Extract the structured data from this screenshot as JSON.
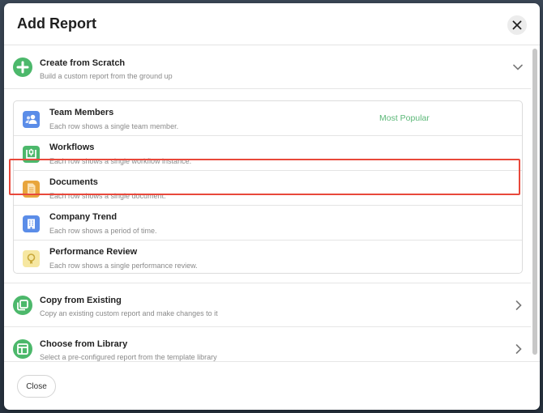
{
  "dialog": {
    "title": "Add Report",
    "close_icon": "close-icon"
  },
  "sections": {
    "create": {
      "title": "Create from Scratch",
      "subtitle": "Build a custom report from the ground up",
      "icon": "plus-circle-icon",
      "expanded": true
    },
    "copy": {
      "title": "Copy from Existing",
      "subtitle": "Copy an existing custom report and make changes to it",
      "icon": "copy-icon"
    },
    "library": {
      "title": "Choose from Library",
      "subtitle": "Select a pre-configured report from the template library",
      "icon": "layout-icon"
    }
  },
  "reports": [
    {
      "title": "Team Members",
      "subtitle": "Each row shows a single team member.",
      "badge": "Most Popular",
      "icon": "people-icon",
      "color": "#5b8de8"
    },
    {
      "title": "Workflows",
      "subtitle": "Each row shows a single workflow instance.",
      "icon": "workflow-icon",
      "color": "#4cb86b"
    },
    {
      "title": "Documents",
      "subtitle": "Each row shows a single document.",
      "icon": "document-icon",
      "color": "#e8a53c"
    },
    {
      "title": "Company Trend",
      "subtitle": "Each row shows a period of time.",
      "icon": "building-icon",
      "color": "#5b8de8",
      "highlighted": true
    },
    {
      "title": "Performance Review",
      "subtitle": "Each row shows a single performance review.",
      "icon": "award-icon",
      "color": "#f6e7a1"
    }
  ],
  "footer": {
    "close_label": "Close"
  },
  "colors": {
    "accent_green": "#4cb86b",
    "highlight_red": "#e8483b",
    "badge_green": "#5cb878"
  }
}
